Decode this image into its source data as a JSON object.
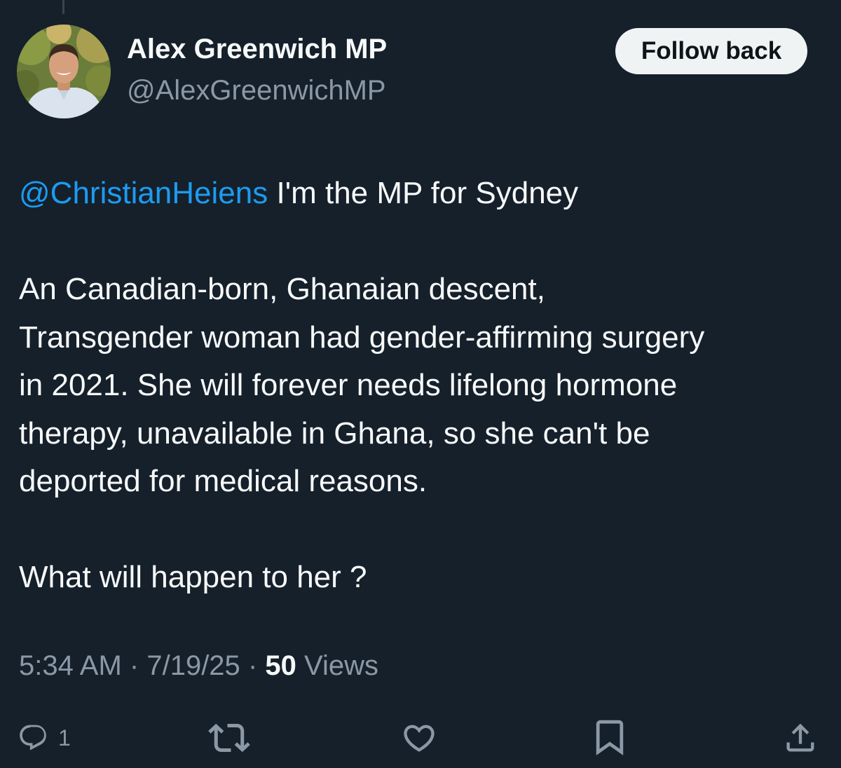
{
  "tweet": {
    "author": {
      "name": "Alex Greenwich MP",
      "handle": "@AlexGreenwichMP",
      "avatar_icon": "profile-photo"
    },
    "follow_button_label": "Follow back",
    "mention": "@ChristianHeiens",
    "text_first_line": " I'm the MP for Sydney",
    "paragraph_2_lines": [
      "An Canadian-born, Ghanaian descent,",
      "Transgender woman had gender-affirming surgery",
      "in 2021. She will forever needs lifelong hormone",
      "therapy, unavailable in Ghana, so she can't be",
      "deported for medical reasons."
    ],
    "paragraph_3": "What will happen to her ?",
    "time": "5:34 AM",
    "separator": "·",
    "date": "7/19/25",
    "views_count": "50",
    "views_label": "Views",
    "reply_count": "1"
  },
  "icons": {
    "reply": "reply-icon",
    "retweet": "retweet-icon",
    "like": "heart-icon",
    "bookmark": "bookmark-icon",
    "share": "share-icon"
  },
  "colors": {
    "background": "#15202b",
    "text": "#f7f9f9",
    "secondary_text": "#8b98a5",
    "link": "#1d9bf0",
    "button_bg": "#eff3f4"
  }
}
